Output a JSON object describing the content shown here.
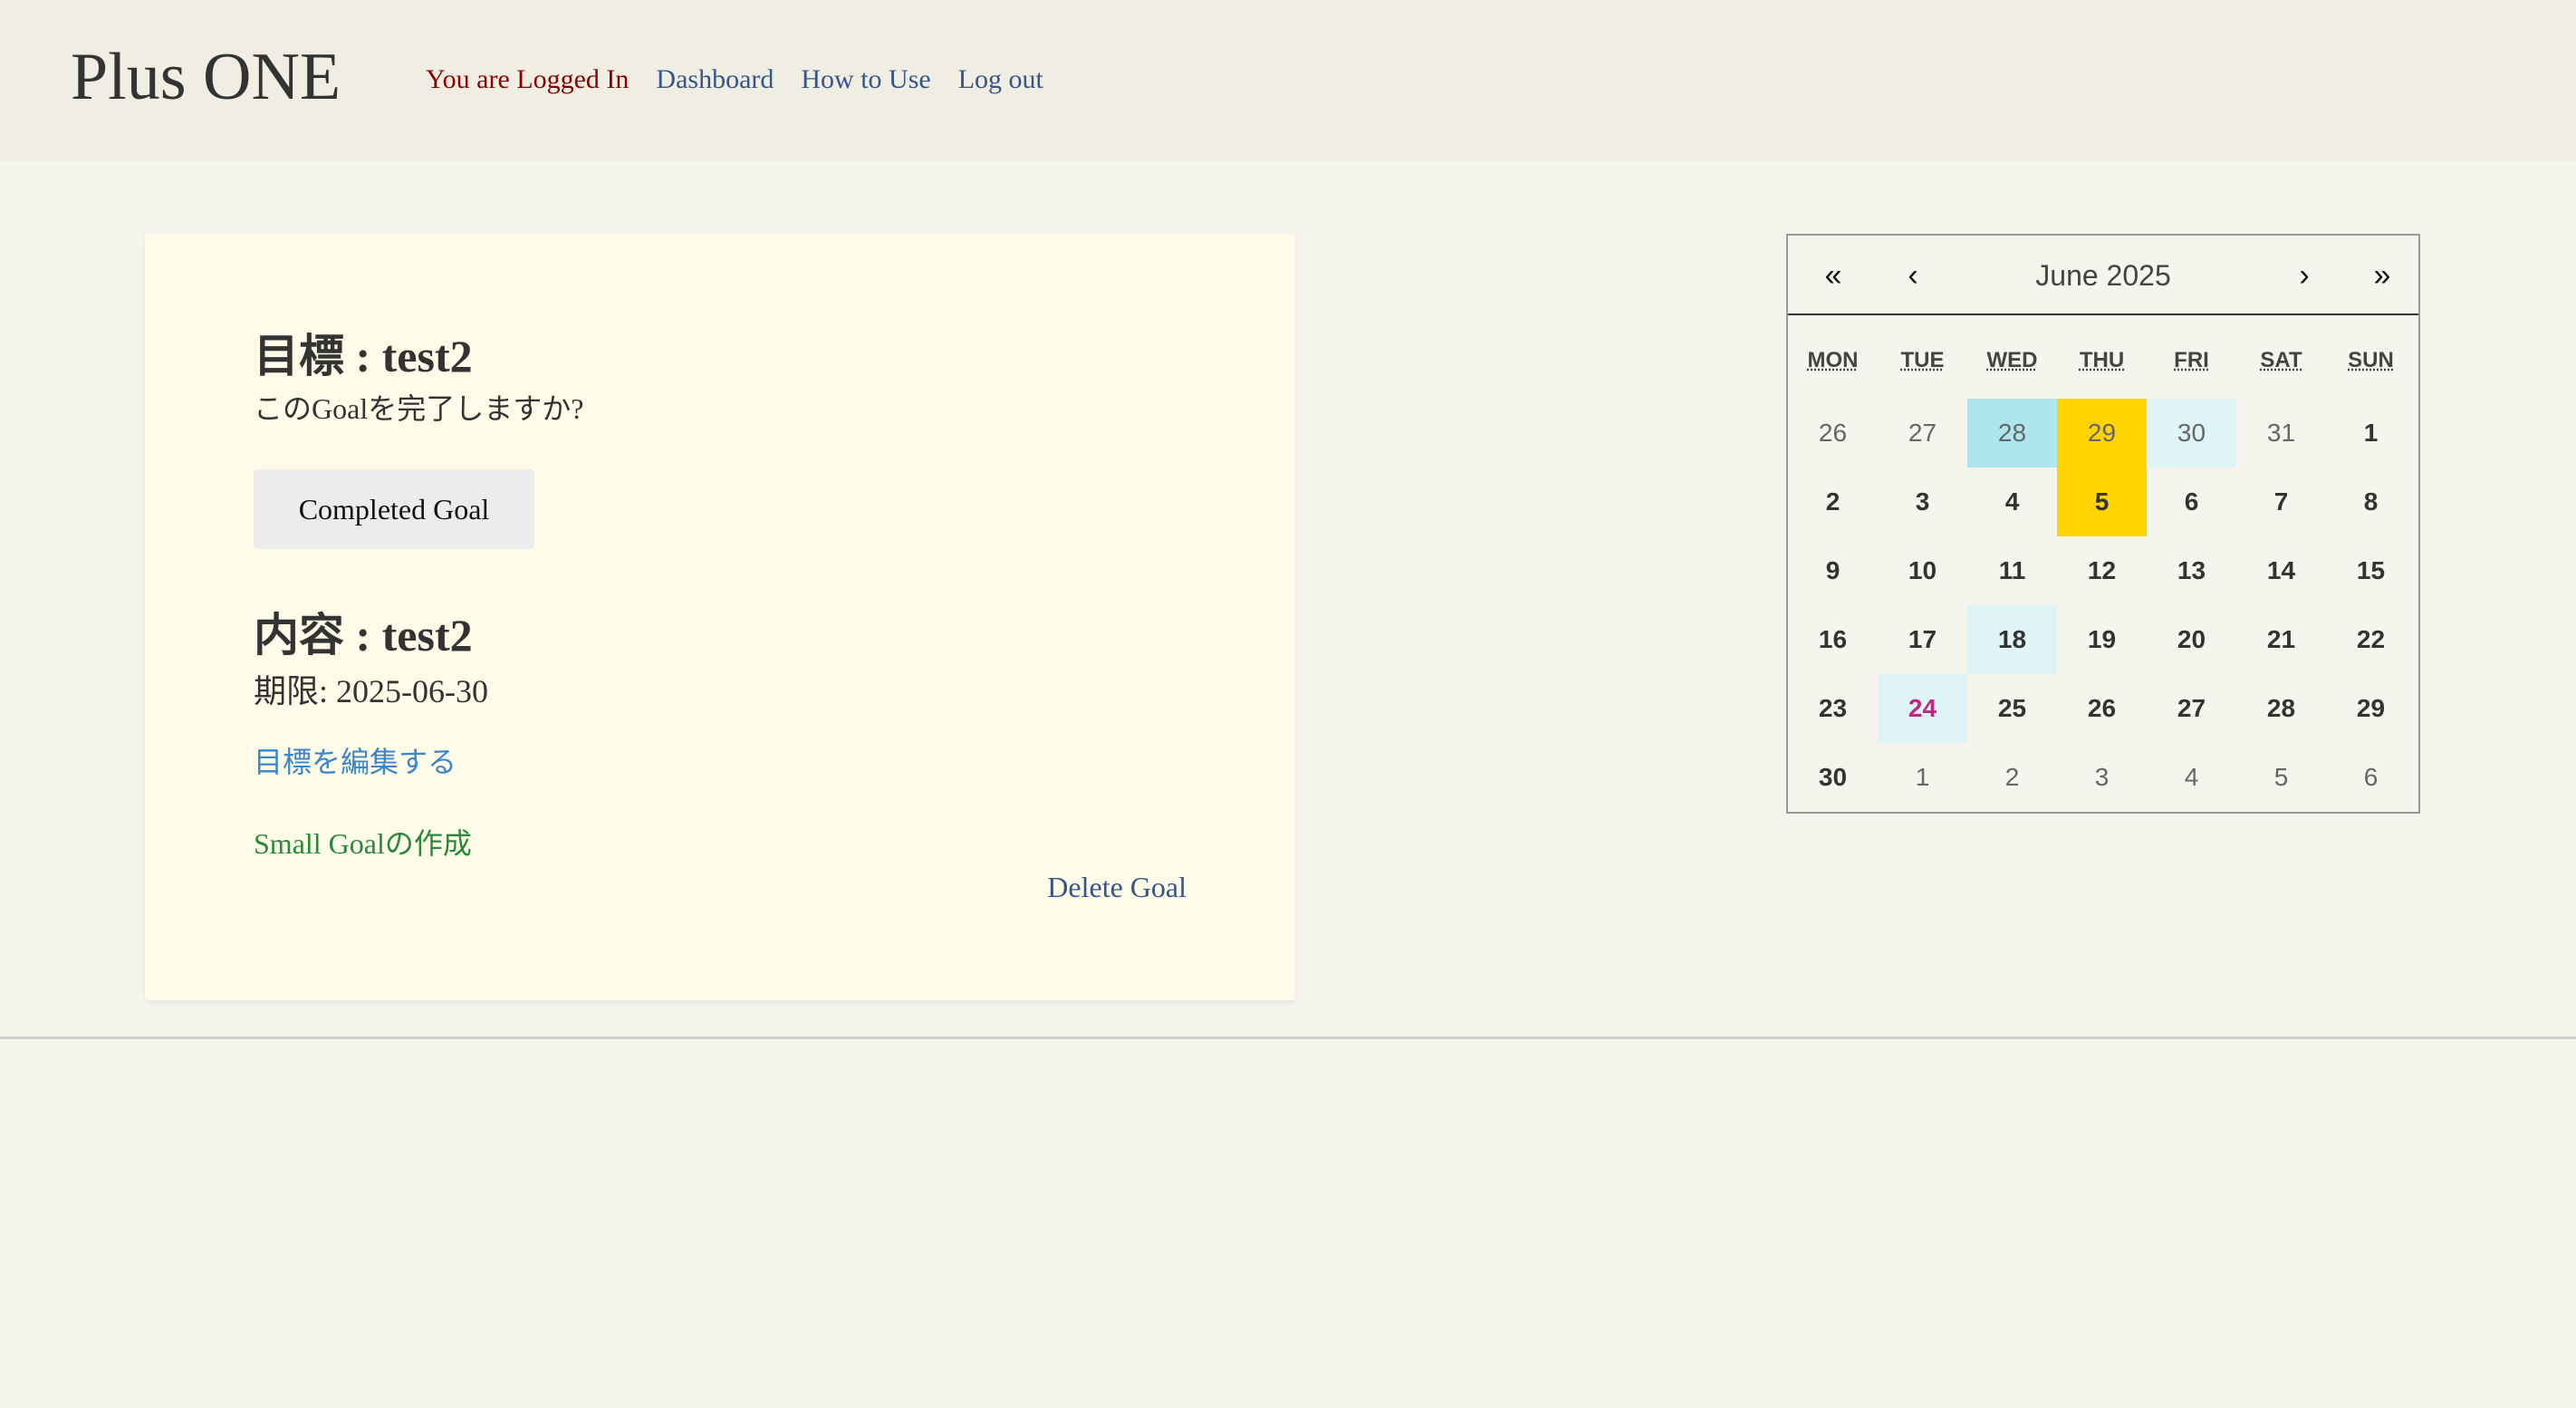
{
  "header": {
    "brand": "Plus ONE",
    "status": "You are Logged In",
    "nav": [
      "Dashboard",
      "How to Use",
      "Log out"
    ]
  },
  "goal": {
    "title": "目標 : test2",
    "question": "このGoalを完了しますか?",
    "complete_button": "Completed Goal",
    "content_title": "内容 : test2",
    "deadline": "期限: 2025-06-30",
    "edit_link": "目標を編集する",
    "small_goal_link": "Small Goalの作成",
    "delete_link": "Delete Goal"
  },
  "calendar": {
    "nav": {
      "prev_year": "«",
      "prev_month": "‹",
      "label": "June 2025",
      "next_month": "›",
      "next_year": "»"
    },
    "weekdays": [
      "MON",
      "TUE",
      "WED",
      "THU",
      "FRI",
      "SAT",
      "SUN"
    ],
    "weeks": [
      [
        {
          "d": "26",
          "style": "muted"
        },
        {
          "d": "27",
          "style": "muted"
        },
        {
          "d": "28",
          "style": "muted cyan"
        },
        {
          "d": "29",
          "style": "muted gold"
        },
        {
          "d": "30",
          "style": "muted light"
        },
        {
          "d": "31",
          "style": "muted"
        },
        {
          "d": "1",
          "style": "bold"
        }
      ],
      [
        {
          "d": "2",
          "style": "bold"
        },
        {
          "d": "3",
          "style": "bold"
        },
        {
          "d": "4",
          "style": "bold"
        },
        {
          "d": "5",
          "style": "bold gold"
        },
        {
          "d": "6",
          "style": "bold"
        },
        {
          "d": "7",
          "style": "bold"
        },
        {
          "d": "8",
          "style": "bold"
        }
      ],
      [
        {
          "d": "9",
          "style": "bold"
        },
        {
          "d": "10",
          "style": "bold"
        },
        {
          "d": "11",
          "style": "bold"
        },
        {
          "d": "12",
          "style": "bold"
        },
        {
          "d": "13",
          "style": "bold"
        },
        {
          "d": "14",
          "style": "bold"
        },
        {
          "d": "15",
          "style": "bold"
        }
      ],
      [
        {
          "d": "16",
          "style": "bold"
        },
        {
          "d": "17",
          "style": "bold"
        },
        {
          "d": "18",
          "style": "bold light"
        },
        {
          "d": "19",
          "style": "bold"
        },
        {
          "d": "20",
          "style": "bold"
        },
        {
          "d": "21",
          "style": "bold"
        },
        {
          "d": "22",
          "style": "bold"
        }
      ],
      [
        {
          "d": "23",
          "style": "bold"
        },
        {
          "d": "24",
          "style": "bold light today"
        },
        {
          "d": "25",
          "style": "bold"
        },
        {
          "d": "26",
          "style": "bold"
        },
        {
          "d": "27",
          "style": "bold"
        },
        {
          "d": "28",
          "style": "bold"
        },
        {
          "d": "29",
          "style": "bold"
        }
      ],
      [
        {
          "d": "30",
          "style": "bold"
        },
        {
          "d": "1",
          "style": "muted"
        },
        {
          "d": "2",
          "style": "muted"
        },
        {
          "d": "3",
          "style": "muted"
        },
        {
          "d": "4",
          "style": "muted"
        },
        {
          "d": "5",
          "style": "muted"
        },
        {
          "d": "6",
          "style": "muted"
        }
      ]
    ]
  },
  "colors": {
    "status_red": "#8b0000",
    "link_blue": "#36558a",
    "edit_blue": "#3a86c8",
    "small_goal_green": "#2a8a3a",
    "highlight_gold": "#ffd400",
    "highlight_cyan": "#ade6ee",
    "highlight_light": "#dff4f6",
    "today_magenta": "#c0267f"
  }
}
